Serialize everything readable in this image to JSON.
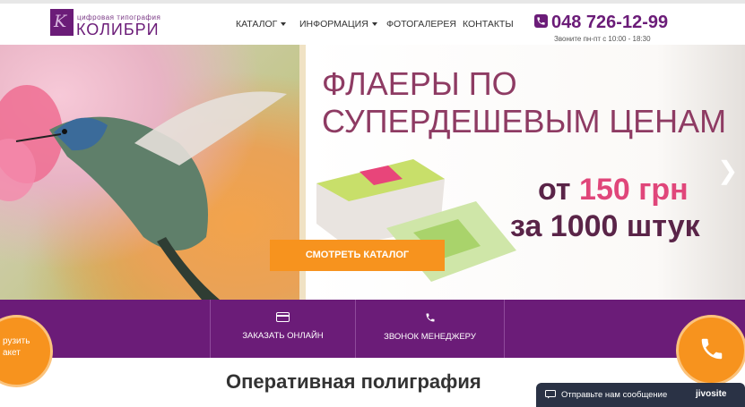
{
  "header": {
    "logo_subtitle": "цифровая типография",
    "logo_name": "КОЛИБРИ",
    "nav": [
      {
        "label": "КАТАЛОГ",
        "dropdown": true
      },
      {
        "label": "ИНФОРМАЦИЯ",
        "dropdown": true
      },
      {
        "label": "ФОТОГАЛЕРЕЯ",
        "dropdown": false
      },
      {
        "label": "КОНТАКТЫ",
        "dropdown": false
      }
    ],
    "phone": "048 726-12-99",
    "hours": "Звоните пн-пт с 10:00 - 18:30"
  },
  "hero": {
    "title_line1": "ФЛАЕРЫ ПО",
    "title_line2": "СУПЕРДЕШЕВЫМ ЦЕНАМ",
    "price_prefix": "от ",
    "price_value": "150 грн",
    "price_line2": "за 1000 штук",
    "cta_label": "СМОТРЕТЬ КАТАЛОГ"
  },
  "actions": {
    "order_online": "ЗАКАЗАТЬ ОНЛАЙН",
    "call_manager": "ЗВОНОК МЕНЕДЖЕРУ",
    "cart_line1": "рузить",
    "cart_line2": "акет"
  },
  "section": {
    "title": "Оперативная полиграфия"
  },
  "chat": {
    "message": "Отправьте нам сообщение",
    "brand": "jivosite"
  },
  "colors": {
    "brand": "#6b1c78",
    "accent": "#f7931e",
    "chat_bg": "#2a3245"
  }
}
